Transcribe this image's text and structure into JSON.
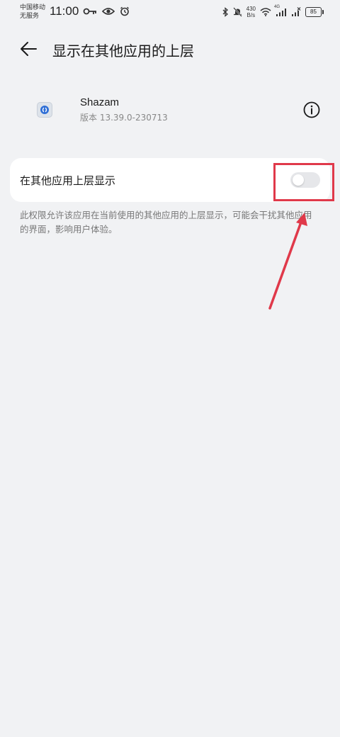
{
  "status_bar": {
    "carrier_line1": "中国移动",
    "carrier_line2": "无服务",
    "time": "11:00",
    "net_speed_value": "430",
    "net_speed_unit": "B/s",
    "network_label": "4G",
    "battery": "85",
    "icons": [
      "key-icon",
      "eye-icon",
      "alarm-icon",
      "bluetooth-icon",
      "mute-bell-icon",
      "wifi-icon",
      "signal-icon",
      "signal-no-sim-icon",
      "battery-icon"
    ]
  },
  "header": {
    "title": "显示在其他应用的上层",
    "back_icon": "back-arrow-icon"
  },
  "app": {
    "name": "Shazam",
    "version": "版本 13.39.0-230713",
    "info_icon": "info-icon"
  },
  "setting": {
    "label": "在其他应用上层显示",
    "enabled": false,
    "description": "此权限允许该应用在当前使用的其他应用的上层显示，可能会干扰其他应用的界面，影响用户体验。"
  },
  "colors": {
    "background": "#f1f2f4",
    "card": "#ffffff",
    "annotation": "#e0394a",
    "toggle_off": "#e6e7ea"
  }
}
